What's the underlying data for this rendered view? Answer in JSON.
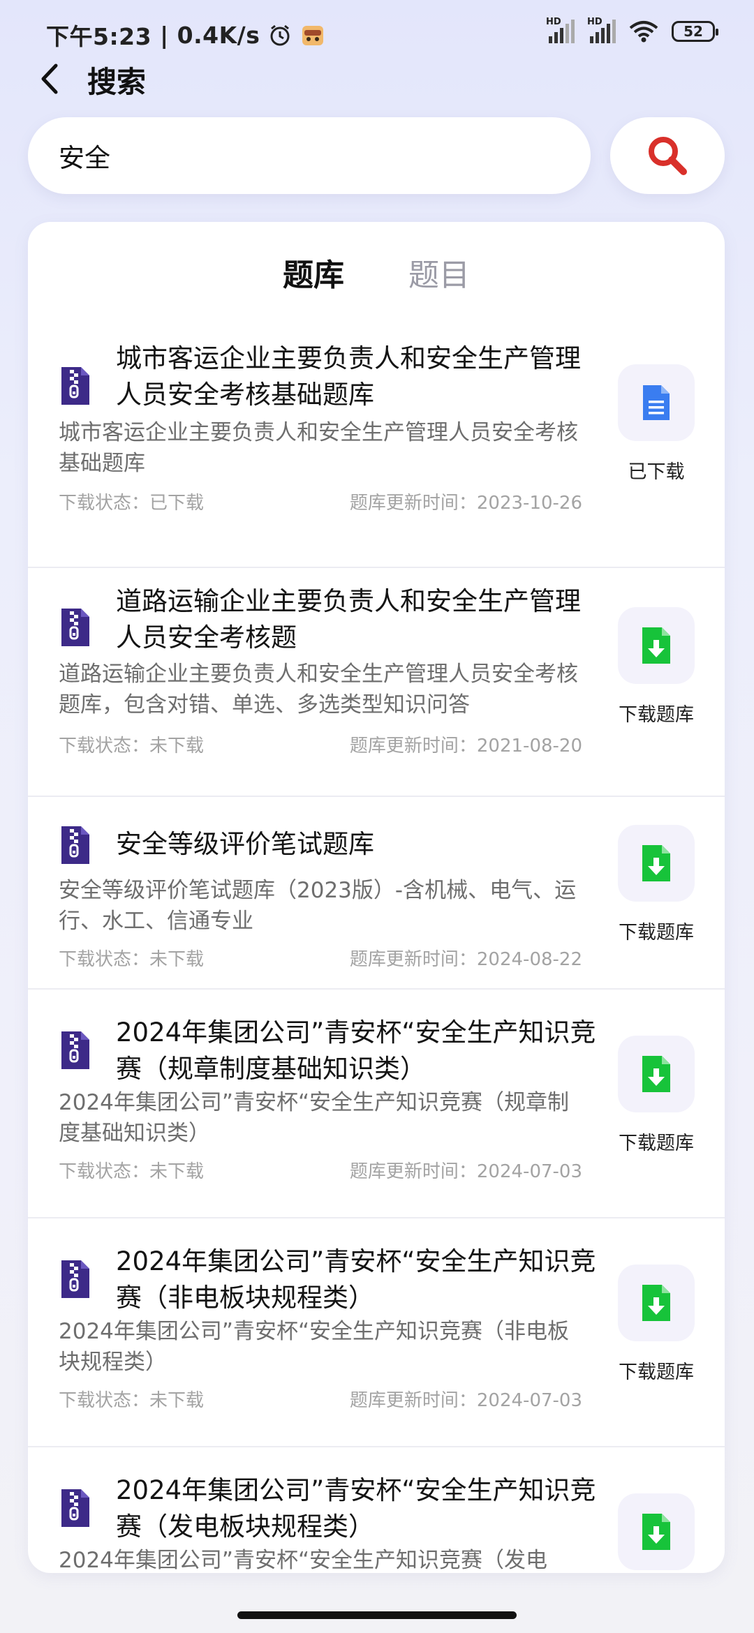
{
  "status_bar": {
    "time": "下午5:23",
    "net_speed": "0.4K/s",
    "signal1_label": "HD",
    "signal2_label": "HD",
    "battery": "52"
  },
  "header": {
    "title": "搜索"
  },
  "search": {
    "value": "安全"
  },
  "tabs": [
    {
      "label": "题库",
      "active": true
    },
    {
      "label": "题目",
      "active": false
    }
  ],
  "items": [
    {
      "title": "城市客运企业主要负责人和安全生产管理人员安全考核基础题库",
      "description": "城市客运企业主要负责人和安全生产管理人员安全考核基础题库",
      "status": "下载状态：已下载",
      "updated": "题库更新时间：2023-10-26",
      "action_label": "已下载",
      "action_icon": "document-icon"
    },
    {
      "title": "道路运输企业主要负责人和安全生产管理人员安全考核题",
      "description": "道路运输企业主要负责人和安全生产管理人员安全考核题库，包含对错、单选、多选类型知识问答",
      "status": "下载状态：未下载",
      "updated": "题库更新时间：2021-08-20",
      "action_label": "下载题库",
      "action_icon": "download-icon"
    },
    {
      "title": "安全等级评价笔试题库",
      "description": "安全等级评价笔试题库（2023版）-含机械、电气、运行、水工、信通专业",
      "status": "下载状态：未下载",
      "updated": "题库更新时间：2024-08-22",
      "action_label": "下载题库",
      "action_icon": "download-icon"
    },
    {
      "title": "2024年集团公司”青安杯“安全生产知识竞赛（规章制度基础知识类）",
      "description": "2024年集团公司”青安杯“安全生产知识竞赛（规章制度基础知识类）",
      "status": "下载状态：未下载",
      "updated": "题库更新时间：2024-07-03",
      "action_label": "下载题库",
      "action_icon": "download-icon"
    },
    {
      "title": "2024年集团公司”青安杯“安全生产知识竞赛（非电板块规程类）",
      "description": "2024年集团公司”青安杯“安全生产知识竞赛（非电板块规程类）",
      "status": "下载状态：未下载",
      "updated": "题库更新时间：2024-07-03",
      "action_label": "下载题库",
      "action_icon": "download-icon"
    },
    {
      "title": "2024年集团公司”青安杯“安全生产知识竞赛（发电板块规程类）",
      "description": "2024年集团公司”青安杯“安全生产知识竞赛（发电",
      "status": "",
      "updated": "",
      "action_label": "",
      "action_icon": "download-icon"
    }
  ],
  "colors": {
    "accent_red": "#d9302a",
    "download_green": "#17c33a",
    "doc_blue": "#3a7df0",
    "zip_purple": "#3d2a88"
  }
}
